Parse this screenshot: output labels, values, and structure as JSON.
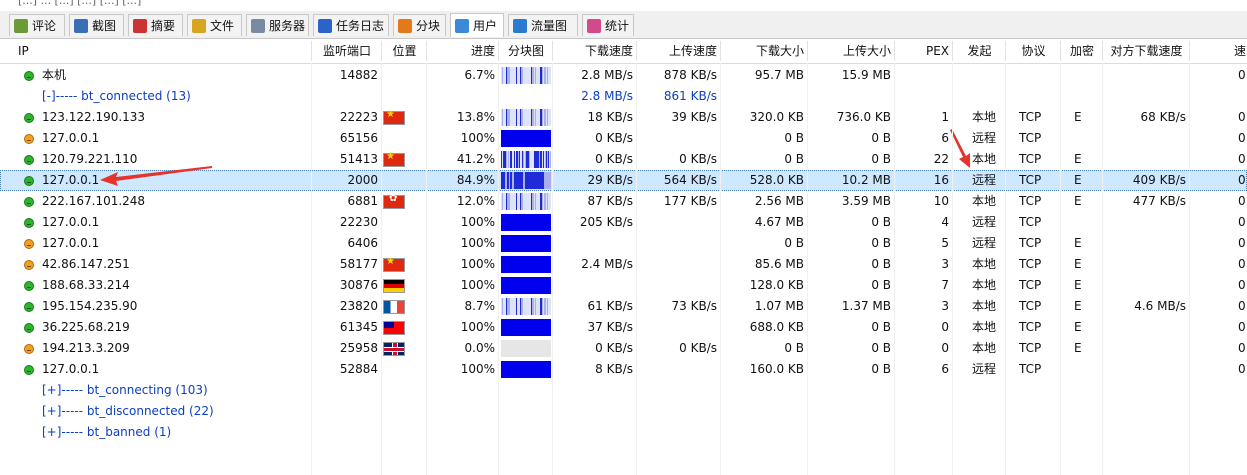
{
  "top_strip_text": "[...] ... [...] [...] [...] [...]",
  "tabs": [
    {
      "label": "评论",
      "icon": "comment-icon",
      "active": false
    },
    {
      "label": "截图",
      "icon": "screenshot-icon",
      "active": false
    },
    {
      "label": "摘要",
      "icon": "summary-icon",
      "active": false
    },
    {
      "label": "文件",
      "icon": "file-icon",
      "active": false
    },
    {
      "label": "服务器",
      "icon": "server-icon",
      "active": false
    },
    {
      "label": "任务日志",
      "icon": "info-icon",
      "active": false
    },
    {
      "label": "分块",
      "icon": "pie-icon",
      "active": false
    },
    {
      "label": "用户",
      "icon": "user-icon",
      "active": true
    },
    {
      "label": "流量图",
      "icon": "graph-icon",
      "active": false
    },
    {
      "label": "统计",
      "icon": "stats-icon",
      "active": false
    }
  ],
  "columns": [
    "IP",
    "监听端口",
    "位置",
    "进度",
    "分块图",
    "下载速度",
    "上传速度",
    "下载大小",
    "上传大小",
    "PEX",
    "发起",
    "协议",
    "加密",
    "对方下载速度",
    "速"
  ],
  "rows": [
    {
      "kind": "peer",
      "status": "green",
      "ip": "本机",
      "port": "14882",
      "flag": "",
      "progress": "6.7%",
      "bar": "light",
      "dl": "2.8 MB/s",
      "ul": "878 KB/s",
      "dlsize": "95.7 MB",
      "ulsize": "15.9 MB",
      "pex": "",
      "init": "",
      "proto": "",
      "enc": "",
      "peerdl": "",
      "edge": "0"
    },
    {
      "kind": "group",
      "label": "[-]----- bt_connected (13)",
      "dl": "2.8 MB/s",
      "ul": "861 KB/s"
    },
    {
      "kind": "peer",
      "status": "green",
      "ip": "123.122.190.133",
      "port": "22223",
      "flag": "cn",
      "progress": "13.8%",
      "bar": "light",
      "dl": "18 KB/s",
      "ul": "39 KB/s",
      "dlsize": "320.0 KB",
      "ulsize": "736.0 KB",
      "pex": "1",
      "init": "本地",
      "proto": "TCP",
      "enc": "E",
      "peerdl": "68 KB/s",
      "edge": "0"
    },
    {
      "kind": "peer",
      "status": "orange",
      "ip": "127.0.0.1",
      "port": "65156",
      "flag": "",
      "progress": "100%",
      "bar": "full",
      "dl": "0 KB/s",
      "ul": "",
      "dlsize": "0 B",
      "ulsize": "0 B",
      "pex": "6",
      "init": "远程",
      "proto": "TCP",
      "enc": "",
      "peerdl": "",
      "edge": "0"
    },
    {
      "kind": "peer",
      "status": "green",
      "ip": "120.79.221.110",
      "port": "51413",
      "flag": "cn",
      "progress": "41.2%",
      "bar": "medium",
      "dl": "0 KB/s",
      "ul": "0 KB/s",
      "dlsize": "0 B",
      "ulsize": "0 B",
      "pex": "22",
      "init": "本地",
      "proto": "TCP",
      "enc": "E",
      "peerdl": "",
      "edge": "0"
    },
    {
      "kind": "peer",
      "status": "green",
      "ip": "127.0.0.1",
      "port": "2000",
      "flag": "",
      "progress": "84.9%",
      "bar": "mostly",
      "dl": "29 KB/s",
      "ul": "564 KB/s",
      "dlsize": "528.0 KB",
      "ulsize": "10.2 MB",
      "pex": "16",
      "init": "远程",
      "proto": "TCP",
      "enc": "E",
      "peerdl": "409 KB/s",
      "edge": "0",
      "selected": true
    },
    {
      "kind": "peer",
      "status": "green",
      "ip": "222.167.101.248",
      "port": "6881",
      "flag": "hk",
      "progress": "12.0%",
      "bar": "light",
      "dl": "87 KB/s",
      "ul": "177 KB/s",
      "dlsize": "2.56 MB",
      "ulsize": "3.59 MB",
      "pex": "10",
      "init": "本地",
      "proto": "TCP",
      "enc": "E",
      "peerdl": "477 KB/s",
      "edge": "0"
    },
    {
      "kind": "peer",
      "status": "green",
      "ip": "127.0.0.1",
      "port": "22230",
      "flag": "",
      "progress": "100%",
      "bar": "full",
      "dl": "205 KB/s",
      "ul": "",
      "dlsize": "4.67 MB",
      "ulsize": "0 B",
      "pex": "4",
      "init": "远程",
      "proto": "TCP",
      "enc": "",
      "peerdl": "",
      "edge": "0"
    },
    {
      "kind": "peer",
      "status": "orange",
      "ip": "127.0.0.1",
      "port": "6406",
      "flag": "",
      "progress": "100%",
      "bar": "full",
      "dl": "",
      "ul": "",
      "dlsize": "0 B",
      "ulsize": "0 B",
      "pex": "5",
      "init": "远程",
      "proto": "TCP",
      "enc": "E",
      "peerdl": "",
      "edge": "0"
    },
    {
      "kind": "peer",
      "status": "orange",
      "ip": "42.86.147.251",
      "port": "58177",
      "flag": "cn",
      "progress": "100%",
      "bar": "full",
      "dl": "2.4 MB/s",
      "ul": "",
      "dlsize": "85.6 MB",
      "ulsize": "0 B",
      "pex": "3",
      "init": "本地",
      "proto": "TCP",
      "enc": "E",
      "peerdl": "",
      "edge": "0"
    },
    {
      "kind": "peer",
      "status": "green",
      "ip": "188.68.33.214",
      "port": "30876",
      "flag": "de",
      "progress": "100%",
      "bar": "full",
      "dl": "",
      "ul": "",
      "dlsize": "128.0 KB",
      "ulsize": "0 B",
      "pex": "7",
      "init": "本地",
      "proto": "TCP",
      "enc": "E",
      "peerdl": "",
      "edge": "0"
    },
    {
      "kind": "peer",
      "status": "green",
      "ip": "195.154.235.90",
      "port": "23820",
      "flag": "fr",
      "progress": "8.7%",
      "bar": "light",
      "dl": "61 KB/s",
      "ul": "73 KB/s",
      "dlsize": "1.07 MB",
      "ulsize": "1.37 MB",
      "pex": "3",
      "init": "本地",
      "proto": "TCP",
      "enc": "E",
      "peerdl": "4.6 MB/s",
      "edge": "0"
    },
    {
      "kind": "peer",
      "status": "green",
      "ip": "36.225.68.219",
      "port": "61345",
      "flag": "tw",
      "progress": "100%",
      "bar": "full",
      "dl": "37 KB/s",
      "ul": "",
      "dlsize": "688.0 KB",
      "ulsize": "0 B",
      "pex": "0",
      "init": "本地",
      "proto": "TCP",
      "enc": "E",
      "peerdl": "",
      "edge": "0"
    },
    {
      "kind": "peer",
      "status": "orange",
      "ip": "194.213.3.209",
      "port": "25958",
      "flag": "gb",
      "progress": "0.0%",
      "bar": "empty",
      "dl": "0 KB/s",
      "ul": "0 KB/s",
      "dlsize": "0 B",
      "ulsize": "0 B",
      "pex": "0",
      "init": "本地",
      "proto": "TCP",
      "enc": "E",
      "peerdl": "",
      "edge": "0"
    },
    {
      "kind": "peer",
      "status": "green",
      "ip": "127.0.0.1",
      "port": "52884",
      "flag": "",
      "progress": "100%",
      "bar": "full",
      "dl": "8 KB/s",
      "ul": "",
      "dlsize": "160.0 KB",
      "ulsize": "0 B",
      "pex": "6",
      "init": "远程",
      "proto": "TCP",
      "enc": "",
      "peerdl": "",
      "edge": "0"
    },
    {
      "kind": "group",
      "label": "[+]----- bt_connecting (103)",
      "dl": "",
      "ul": ""
    },
    {
      "kind": "group",
      "label": "[+]----- bt_disconnected (22)",
      "dl": "",
      "ul": ""
    },
    {
      "kind": "group",
      "label": "[+]----- bt_banned (1)",
      "dl": "",
      "ul": ""
    }
  ],
  "colors": {
    "selection": "#cde8ff",
    "link_blue": "#0b3ec0",
    "bar_blue": "#0000ee",
    "arrow_red": "#e8332a"
  }
}
